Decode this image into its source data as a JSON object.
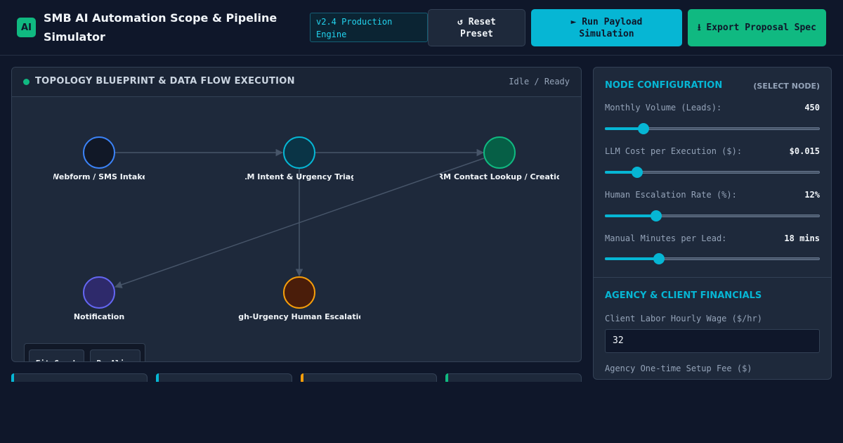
{
  "header": {
    "logo_text": "AI",
    "title": "SMB AI Automation Scope & Pipeline Simulator",
    "version_badge": "v2.4 Production Engine",
    "reset_label": "↺ Reset Preset",
    "run_label": "► Run Payload Simulation",
    "export_label": "⭳ Export Proposal Spec"
  },
  "topology": {
    "title": "TOPOLOGY BLUEPRINT & DATA FLOW EXECUTION",
    "status": "Idle / Ready",
    "nodes": [
      {
        "id": "intake",
        "label": "Webform / SMS Intake",
        "fill": "#111827",
        "stroke": "#3b82f6"
      },
      {
        "id": "triage",
        "label": "LLM Intent & Urgency Triage",
        "fill": "#0a3446",
        "stroke": "#06b6d4"
      },
      {
        "id": "crm",
        "label": "CRM Contact Lookup / Creation",
        "fill": "#065f46",
        "stroke": "#10b981"
      },
      {
        "id": "notify",
        "label": "Notification",
        "fill": "#2e2a6b",
        "stroke": "#6366f1"
      },
      {
        "id": "escalation",
        "label": "High-Urgency Human Escalation",
        "fill": "#4a1d0a",
        "stroke": "#f59e0b"
      }
    ],
    "fit_label": "Fit Graph",
    "realign_label": "Re-Align"
  },
  "config": {
    "title": "NODE CONFIGURATION",
    "select_hint": "(SELECT NODE)",
    "params": [
      {
        "label": "Monthly Volume (Leads):",
        "value": "450",
        "level": 0.18
      },
      {
        "label": "LLM Cost per Execution ($):",
        "value": "$0.015",
        "level": 0.15
      },
      {
        "label": "Human Escalation Rate (%):",
        "value": "12%",
        "level": 0.24
      },
      {
        "label": "Manual Minutes per Lead:",
        "value": "18 mins",
        "level": 0.25
      }
    ],
    "financials_title": "AGENCY & CLIENT FINANCIALS",
    "wage_label": "Client Labor Hourly Wage ($/hr)",
    "wage_value": "32",
    "setup_fee_label": "Agency One-time Setup Fee ($)"
  },
  "stat_cards": [
    {
      "accent": "#06b6d4"
    },
    {
      "accent": "#06b6d4"
    },
    {
      "accent": "#f59e0b"
    },
    {
      "accent": "#10b981"
    }
  ]
}
